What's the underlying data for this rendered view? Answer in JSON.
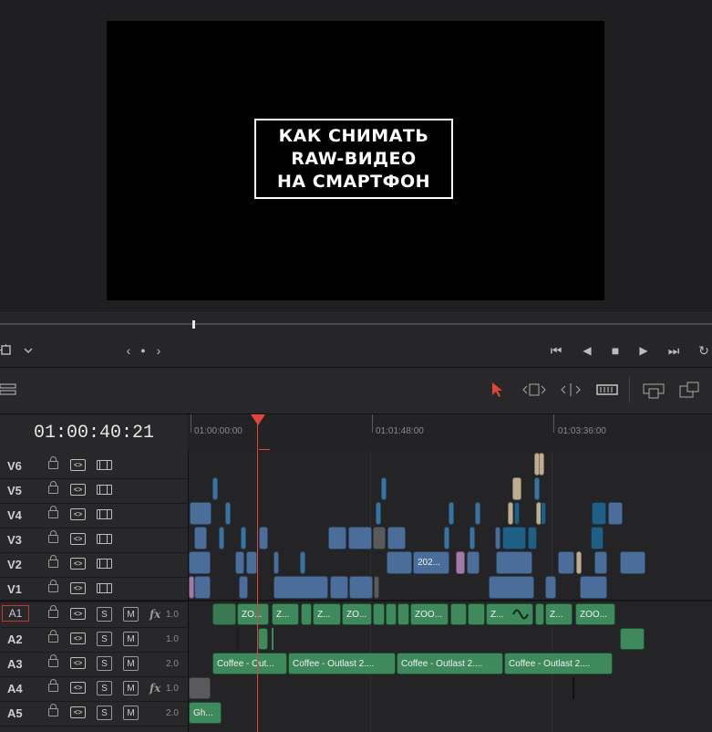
{
  "viewer": {
    "title_lines": [
      "КАК СНИМАТЬ",
      "RAW-ВИДЕО",
      "НА СМАРТФОН"
    ]
  },
  "transport": {
    "nav_prev": "‹",
    "nav_dot": "●",
    "nav_next": "›",
    "first_frame": "⏮",
    "reverse": "◀",
    "stop": "■",
    "play": "▶",
    "last_frame": "⏭",
    "loop": "↻"
  },
  "timeline": {
    "timecode": "01:00:40:21",
    "ruler_labels": [
      "01:00:00:00",
      "01:01:48:00",
      "01:03:36:00"
    ],
    "video_tracks": [
      {
        "name": "V6"
      },
      {
        "name": "V5"
      },
      {
        "name": "V4"
      },
      {
        "name": "V3"
      },
      {
        "name": "V2"
      },
      {
        "name": "V1"
      }
    ],
    "audio_tracks": [
      {
        "name": "A1",
        "s": "S",
        "m": "M",
        "fx": "fx",
        "level": "1.0"
      },
      {
        "name": "A2",
        "s": "S",
        "m": "M",
        "fx": "",
        "level": "1.0"
      },
      {
        "name": "A3",
        "s": "S",
        "m": "M",
        "fx": "",
        "level": "2.0"
      },
      {
        "name": "A4",
        "s": "S",
        "m": "M",
        "fx": "fx",
        "level": "1.0"
      },
      {
        "name": "A5",
        "s": "S",
        "m": "M",
        "fx": "",
        "level": "2.0"
      }
    ],
    "clip_labels": {
      "v2_202": "202...",
      "a1_zoo1": "ZO...",
      "a1_z1": "Z...",
      "a1_z2": "Z...",
      "a1_zoo2": "ZO...",
      "a1_zoo3": "ZOO...",
      "a1_z3": "Z...",
      "a1_z4": "Z...",
      "a1_zoo4": "ZOO...",
      "a3_c1": "Coffee - Out...",
      "a3_c2": "Coffee - Outlast 2....",
      "a3_c3": "Coffee - Outlast 2....",
      "a3_c4": "Coffee - Outlast 2....",
      "a5_gh": "Gh..."
    }
  },
  "colors": {
    "accent_red": "#e0443a",
    "video_clip": "#4a6e99",
    "audio_clip": "#3e8a5c"
  }
}
